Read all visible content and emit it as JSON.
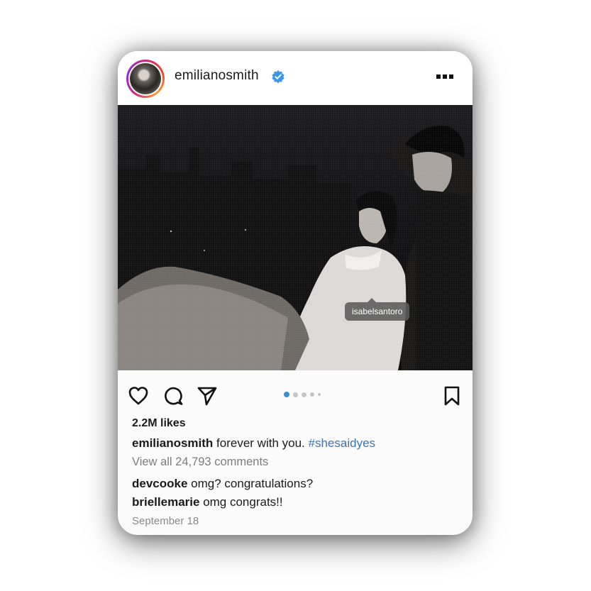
{
  "post": {
    "username": "emilianosmith",
    "tag_label": "isabelsantoro",
    "likes": "2.2M likes",
    "caption": {
      "username": "emilianosmith",
      "text": "forever with you.",
      "hashtag": "#shesaidyes"
    },
    "view_all_comments": "View all 24,793 comments",
    "comments": [
      {
        "username": "devcooke",
        "text": "omg? congratulations?"
      },
      {
        "username": "briellemarie",
        "text": "omg congrats!!"
      }
    ],
    "date": "September 18",
    "carousel": {
      "count": 5,
      "active_index": 0
    }
  },
  "icons": {
    "verified": "verified-badge-icon",
    "more": "more-options-icon",
    "like": "heart-icon",
    "comment": "comment-bubble-icon",
    "share": "paper-plane-icon",
    "save": "bookmark-icon"
  },
  "colors": {
    "verified_blue": "#3b97e3",
    "hashtag_blue": "#3d74b3",
    "active_dot": "#3b8ed4",
    "inactive_dot": "#c5c5c5"
  }
}
